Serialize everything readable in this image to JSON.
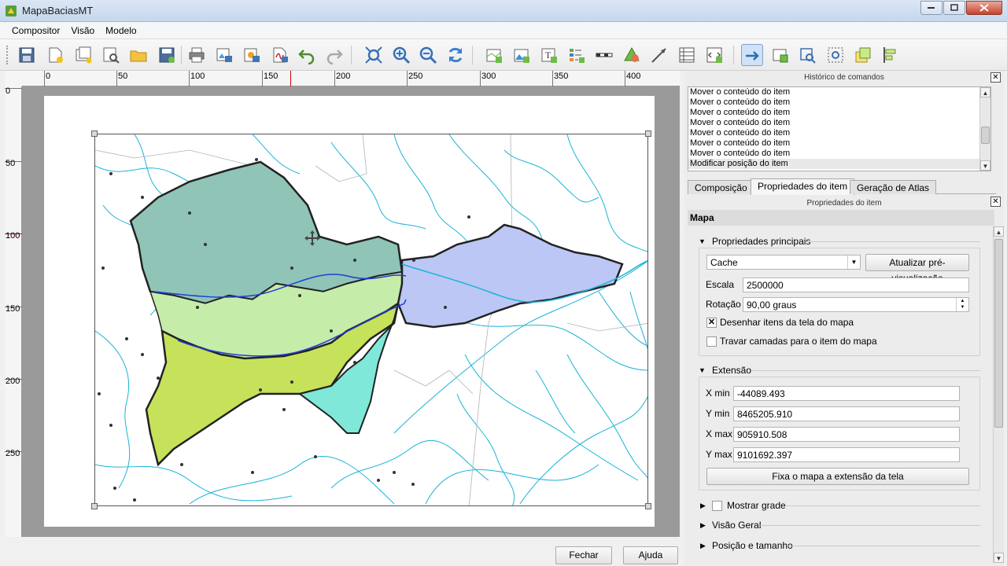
{
  "window": {
    "title": "MapaBaciasMT"
  },
  "menu": [
    "Compositor",
    "Visão",
    "Modelo"
  ],
  "toolbar": {
    "icons": [
      "save-icon",
      "new-composer-icon",
      "duplicate-composer-icon",
      "composer-manager-icon",
      "open-template-icon",
      "save-template-icon",
      "print-icon",
      "export-image-icon",
      "export-svg-icon",
      "export-pdf-icon",
      "undo-icon",
      "redo-icon",
      "zoom-full-icon",
      "zoom-in-icon",
      "zoom-out-icon",
      "refresh-icon",
      "add-map-icon",
      "add-image-icon",
      "add-label-icon",
      "add-legend-icon",
      "add-scalebar-icon",
      "add-shape-icon",
      "add-arrow-icon",
      "add-table-icon",
      "add-html-icon",
      "select-move-icon",
      "move-content-icon",
      "edit-nodes-icon",
      "group-icon",
      "raise-icon",
      "align-icon"
    ]
  },
  "rulers": {
    "h": [
      "0",
      "50",
      "100",
      "150",
      "200",
      "250",
      "300",
      "350",
      "400"
    ],
    "v": [
      "0",
      "50",
      "100",
      "150",
      "200",
      "250"
    ]
  },
  "history": {
    "title": "Histórico de comandos",
    "items": [
      "Mover o conteúdo do item",
      "Mover o conteúdo do item",
      "Mover o conteúdo do item",
      "Mover o conteúdo do item",
      "Mover o conteúdo do item",
      "Mover o conteúdo do item",
      "Mover o conteúdo do item",
      "Modificar posição do item"
    ]
  },
  "tabs": [
    "Composição",
    "Propriedades do item",
    "Geração de Atlas"
  ],
  "item_props": {
    "title": "Propriedades do item",
    "header": "Mapa",
    "main": {
      "title": "Propriedades principais",
      "cache": "Cache",
      "update_preview": "Atualizar pré-visualização",
      "scale_label": "Escala",
      "scale": "2500000",
      "rotation_label": "Rotação",
      "rotation": "90,00 graus",
      "draw_canvas": "Desenhar itens da tela do mapa",
      "lock_layers": "Travar camadas para o item do mapa"
    },
    "extent": {
      "title": "Extensão",
      "xmin_label": "X min",
      "xmin": "-44089.493",
      "ymin_label": "Y min",
      "ymin": "8465205.910",
      "xmax_label": "X max",
      "xmax": "905910.508",
      "ymax_label": "Y max",
      "ymax": "9101692.397",
      "fix_button": "Fixa o mapa a extensão da tela"
    },
    "grid": "Mostrar grade",
    "overview": "Visão Geral",
    "position": "Posição e tamanho"
  },
  "buttons": {
    "close": "Fechar",
    "help": "Ajuda"
  },
  "colors": {
    "basin_teal": "#8fc4b7",
    "basin_lightgreen": "#c6eca9",
    "basin_yellowgreen": "#c6e25a",
    "basin_cyan": "#7fe8d8",
    "basin_lavender": "#bcc7f5",
    "rivers": "#1ab3d8"
  }
}
